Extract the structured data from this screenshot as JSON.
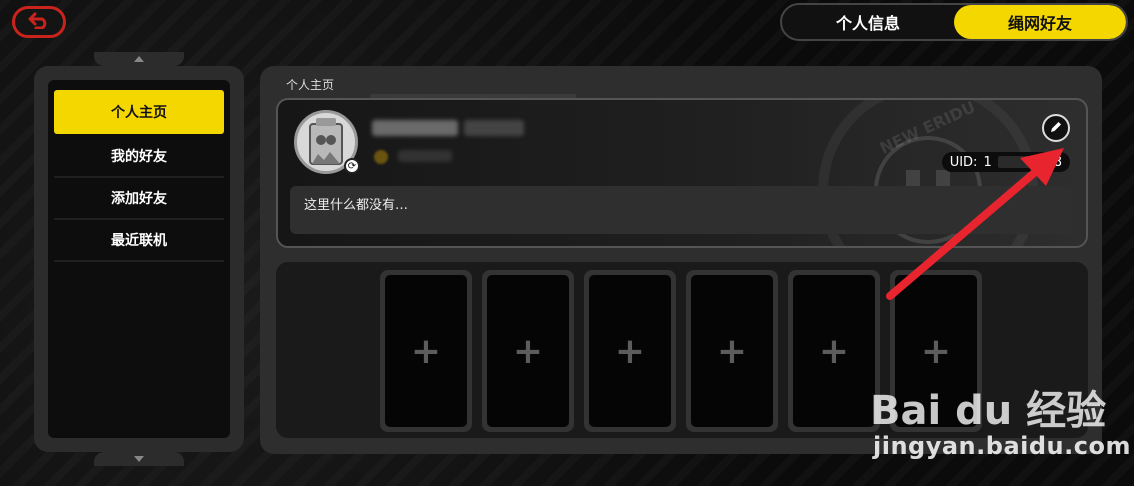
{
  "tabs": [
    {
      "label": "个人信息",
      "active": false
    },
    {
      "label": "绳网好友",
      "active": true
    }
  ],
  "sidebar": {
    "items": [
      {
        "label": "个人主页",
        "active": true
      },
      {
        "label": "我的好友",
        "active": false
      },
      {
        "label": "添加好友",
        "active": false
      },
      {
        "label": "最近联机",
        "active": false
      }
    ]
  },
  "main": {
    "section_title": "个人主页",
    "profile": {
      "uid_label": "UID:",
      "uid_visible_start": "1",
      "uid_visible_end": "8",
      "emblem_text": "NEW ERIDU",
      "signature": "这里什么都没有…"
    },
    "card_slots": [
      {
        "glyph": "+"
      },
      {
        "glyph": "+"
      },
      {
        "glyph": "+"
      },
      {
        "glyph": "+"
      },
      {
        "glyph": "+"
      },
      {
        "glyph": "+"
      }
    ]
  },
  "icons": {
    "back": "back-arrow-icon",
    "edit": "pencil-icon",
    "avatar_badge": "swap-icon"
  },
  "colors": {
    "accent": "#f5d700",
    "back_border": "#c8241c",
    "annotation_arrow": "#e8242e"
  },
  "watermark": {
    "logo": "Bai du 经验",
    "url": "jingyan.baidu.com"
  }
}
